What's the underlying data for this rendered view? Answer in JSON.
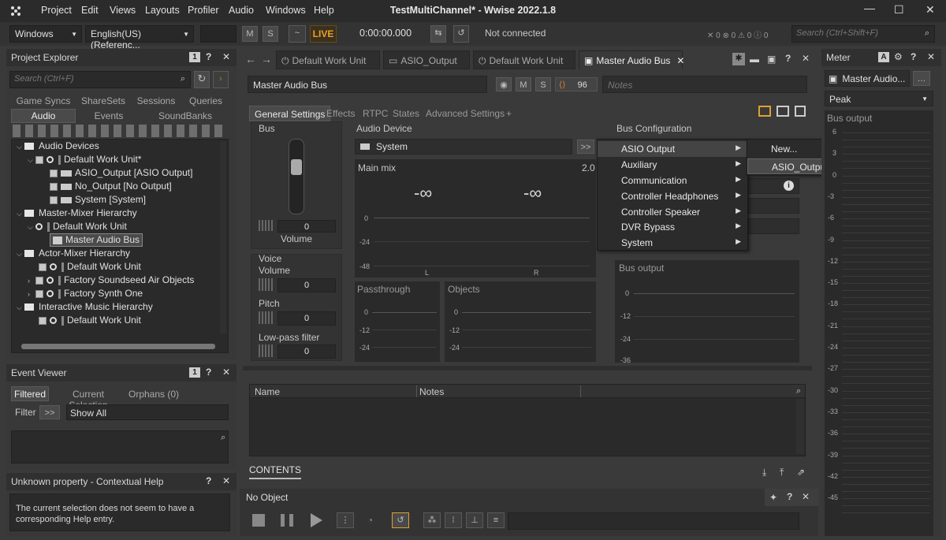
{
  "window": {
    "title": "TestMultiChannel* - Wwise 2022.1.8"
  },
  "menu": [
    "Project",
    "Edit",
    "Views",
    "Layouts",
    "Profiler",
    "Audio",
    "Windows",
    "Help"
  ],
  "toolbar": {
    "platform": "Windows",
    "language": "English(US) (Referenc...",
    "m_label": "M",
    "s_label": "S",
    "live_label": "LIVE",
    "time": "0:00:00.000",
    "connection": "Not connected",
    "counts": [
      "0",
      "0",
      "0",
      "0"
    ],
    "search_placeholder": "Search (Ctrl+Shift+F)"
  },
  "project_explorer": {
    "title": "Project Explorer",
    "badge": "1",
    "search_placeholder": "Search (Ctrl+F)",
    "tabs_row1": [
      "Game Syncs",
      "ShareSets",
      "Sessions",
      "Queries"
    ],
    "tabs_row2": [
      "Audio",
      "Events",
      "SoundBanks"
    ],
    "tree": [
      "Audio Devices",
      "Default Work Unit*",
      "ASIO_Output [ASIO Output]",
      "No_Output [No Output]",
      "System [System]",
      "Master-Mixer Hierarchy",
      "Default Work Unit",
      "Master Audio Bus",
      "Actor-Mixer Hierarchy",
      "Default Work Unit",
      "Factory Soundseed Air Objects",
      "Factory Synth One",
      "Interactive Music Hierarchy",
      "Default Work Unit"
    ]
  },
  "event_viewer": {
    "title": "Event Viewer",
    "badge": "1",
    "tabs": [
      "Filtered",
      "Current Selection",
      "Orphans (0)"
    ],
    "filter_label": "Filter",
    "filter_btn": ">>",
    "filter_value": "Show All"
  },
  "contextual_help": {
    "title": "Unknown property - Contextual Help",
    "text": "The current selection does not seem to have a corresponding Help entry."
  },
  "doc_tabs": [
    "Default Work Unit",
    "ASIO_Output",
    "Default Work Unit",
    "Master Audio Bus"
  ],
  "editor": {
    "name": "Master Audio Bus",
    "m": "M",
    "s": "S",
    "count": "96",
    "notes_placeholder": "Notes",
    "subtabs": [
      "General Settings",
      "Effects",
      "RTPC",
      "States",
      "Advanced Settings",
      "+"
    ],
    "bus_label": "Bus",
    "volume_value": "0",
    "volume_label": "Volume",
    "voice_label": "Voice",
    "voice_volume_label": "Volume",
    "voice_volume_value": "0",
    "pitch_label": "Pitch",
    "pitch_value": "0",
    "lpf_label": "Low-pass filter",
    "lpf_value": "0",
    "audio_device_label": "Audio Device",
    "audio_device_value": "System",
    "audio_device_btn": ">>",
    "main_mix_label": "Main mix",
    "main_mix_channels": "2.0",
    "inf_left": "-∞",
    "inf_right": "-∞",
    "mix_ticks": [
      "0",
      "-24",
      "-48"
    ],
    "ch_left": "L",
    "ch_right": "R",
    "passthrough_label": "Passthrough",
    "objects_label": "Objects",
    "small_ticks": [
      "0",
      "-12",
      "-24"
    ],
    "bus_config_label": "Bus Configuration",
    "bus_output_label": "Bus output",
    "bus_output_ticks": [
      "0",
      "-12",
      "-24",
      "-36"
    ]
  },
  "context_menu": {
    "items": [
      "ASIO Output",
      "Auxiliary",
      "Communication",
      "Controller Headphones",
      "Controller Speaker",
      "DVR Bypass",
      "System"
    ],
    "submenu": [
      "New...",
      "ASIO_Output"
    ]
  },
  "list_view": {
    "col_name": "Name",
    "col_notes": "Notes",
    "footer_tab": "CONTENTS"
  },
  "transport": {
    "title": "No Object"
  },
  "meter": {
    "title": "Meter",
    "bus_name": "Master Audio...",
    "mode": "Peak",
    "section_label": "Bus output",
    "ticks": [
      "6",
      "3",
      "0",
      "-3",
      "-6",
      "-9",
      "-12",
      "-15",
      "-18",
      "-21",
      "-24",
      "-27",
      "-30",
      "-33",
      "-36",
      "-39",
      "-42",
      "-45"
    ]
  }
}
